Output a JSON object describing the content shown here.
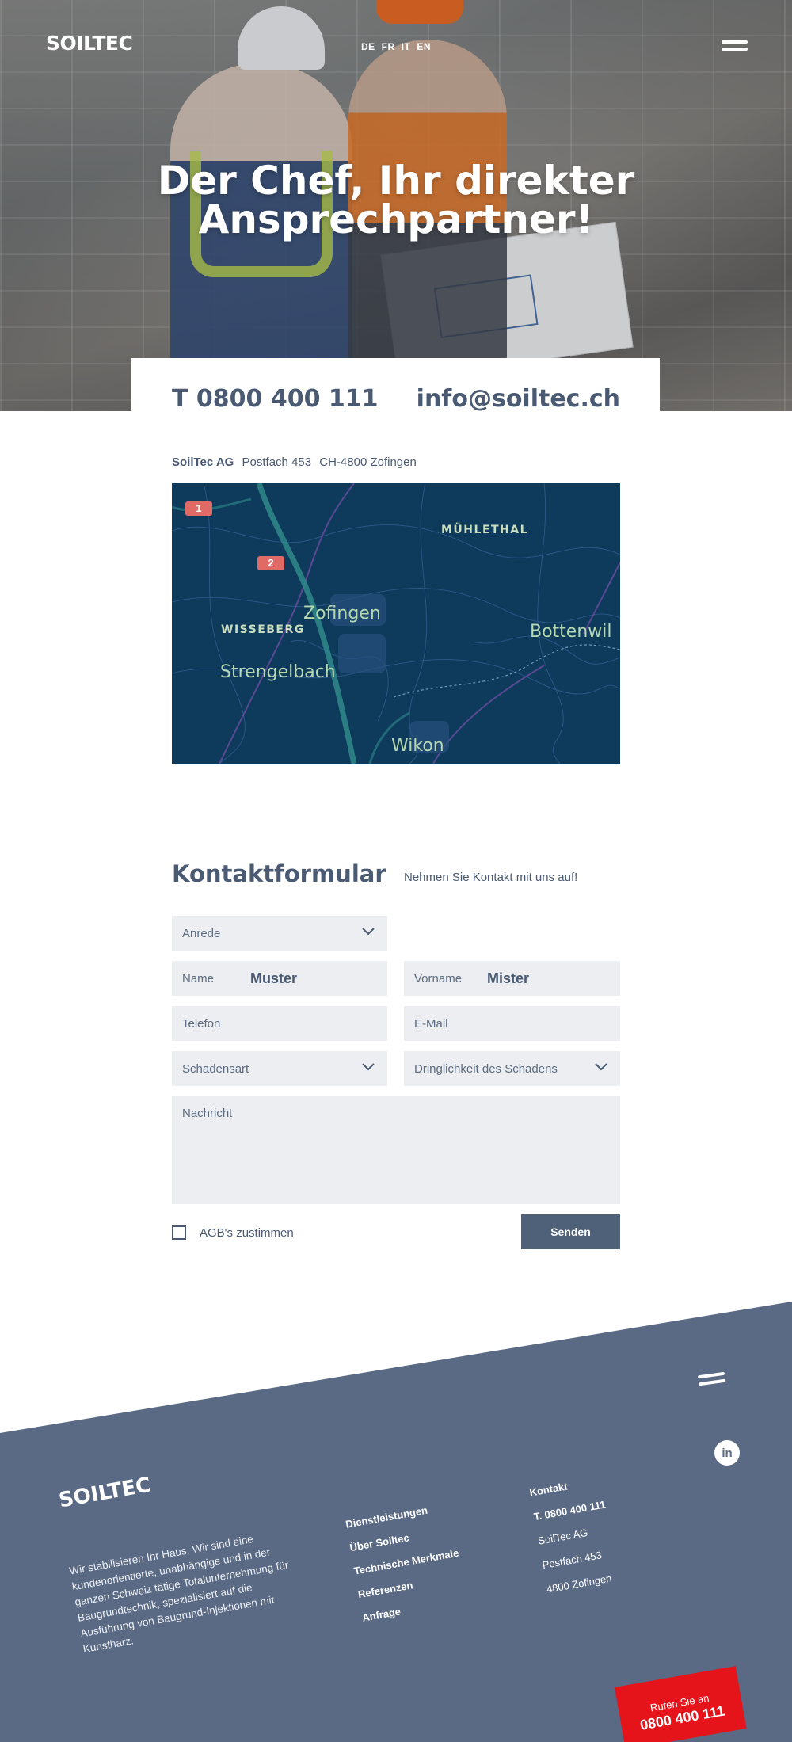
{
  "header": {
    "logo": "SOILTEC",
    "languages": [
      "DE",
      "FR",
      "IT",
      "EN"
    ],
    "hero_title_line1": "Der Chef, Ihr direkter",
    "hero_title_line2": "Ansprechpartner!"
  },
  "contact": {
    "phone": "T 0800 400 111",
    "email": "info@soiltec.ch",
    "company": "SoilTec AG",
    "postbox": "Postfach 453",
    "city": "CH-4800 Zofingen"
  },
  "map": {
    "pin1": "1",
    "pin2": "2",
    "places": {
      "muehlethal": "MÜHLETHAL",
      "zofingen": "Zofingen",
      "wisseberg": "WISSEBERG",
      "bottenwil": "Bottenwil",
      "strengelbach": "Strengelbach",
      "wikon": "Wikon"
    }
  },
  "form": {
    "title": "Kontaktformular",
    "subtitle": "Nehmen Sie Kontakt mit uns auf!",
    "anrede": "Anrede",
    "name_label": "Name",
    "name_value": "Muster",
    "vorname_label": "Vorname",
    "vorname_value": "Mister",
    "telefon": "Telefon",
    "email": "E-Mail",
    "schadensart": "Schadensart",
    "dringlichkeit": "Dringlichkeit des Schadens",
    "nachricht": "Nachricht",
    "agb": "AGB's zustimmen",
    "send": "Senden"
  },
  "footer": {
    "logo": "SOILTEC",
    "text": "Wir stabilisieren Ihr Haus. Wir sind eine kundenorientierte, unabhängige und in der ganzen Schweiz tätige Totalunternehmung für Baugrundtechnik, spezialisiert auf die Ausführung von Baugrund-Injektionen mit Kunstharz.",
    "nav": [
      "Dienstleistungen",
      "Über Soiltec",
      "Technische Merkmale",
      "Referenzen",
      "Anfrage"
    ],
    "contact_title": "Kontakt",
    "contact_phone": "T. 0800 400 111",
    "contact_company": "SoilTec AG",
    "contact_postbox": "Postfach 453",
    "contact_city": "4800 Zofingen",
    "linkedin": "in",
    "call_label": "Rufen Sie an",
    "call_number": "0800 400 111"
  },
  "colors": {
    "brand_blue": "#4f6079",
    "footer_bg": "#5a6a84",
    "call_red": "#e5131a",
    "map_bg": "#0e3a5c"
  }
}
